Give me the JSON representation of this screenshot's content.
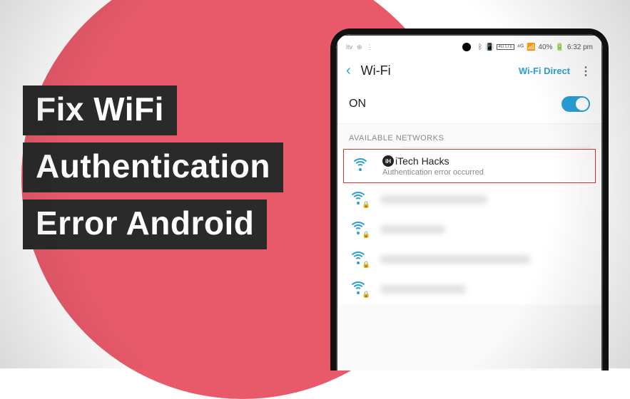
{
  "headline": {
    "line1": "Fix WiFi",
    "line2": "Authentication",
    "line3": "Error Android"
  },
  "status": {
    "carrier": "ltv",
    "network_badge": "4G LTE",
    "signal": "⁴ᴳ",
    "battery_pct": "40%",
    "time": "6:32 pm"
  },
  "wifi": {
    "back": "‹",
    "title": "Wi-Fi",
    "direct_label": "Wi-Fi Direct",
    "menu": "⋮",
    "on_label": "ON",
    "section_label": "AVAILABLE NETWORKS",
    "networks": {
      "highlighted": {
        "name": "iTech Hacks",
        "sub": "Authentication error occurred"
      }
    }
  }
}
